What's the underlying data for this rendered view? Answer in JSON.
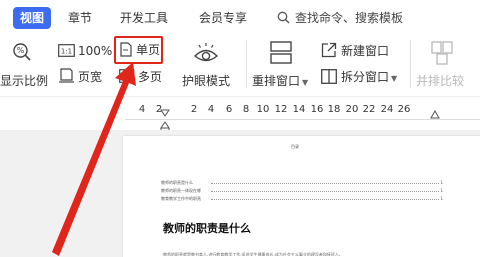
{
  "tabs": [
    {
      "label": "视图",
      "active": true
    },
    {
      "label": "章节",
      "active": false
    },
    {
      "label": "开发工具",
      "active": false
    },
    {
      "label": "会员专享",
      "active": false
    }
  ],
  "search": {
    "label": "查找命令、搜索模板",
    "icon": "search-icon"
  },
  "ribbon": {
    "display_ratio": "显示比例",
    "zoom_100": "100%",
    "page_width": "页宽",
    "single_page": "单页",
    "multi_page": "多页",
    "eye_protect": "护眼模式",
    "rearrange_window": "重排窗口",
    "new_window": "新建窗口",
    "split_window": "拆分窗口",
    "side_by_side": "并排比较"
  },
  "ruler": {
    "ticks": [
      "4",
      "2",
      "",
      "2",
      "4",
      "6",
      "8",
      "10",
      "12",
      "14",
      "16",
      "18",
      "20",
      "22",
      "24",
      "26"
    ]
  },
  "document": {
    "toc_title": "目录",
    "toc_lines": [
      "教师的职责是什么",
      "教师的职责一体现在哪",
      "教育教学工作中的职责"
    ],
    "toc_pages": [
      "1",
      "1",
      "1"
    ],
    "heading": "教师的职责是什么",
    "body_line": "教师的职责就是教书育人,进行教育教学工作,促进学生健康成长,成为社会主义事业的建设者和接班人。"
  },
  "colors": {
    "accent": "#3d6cf0",
    "highlight": "#e0251b"
  }
}
